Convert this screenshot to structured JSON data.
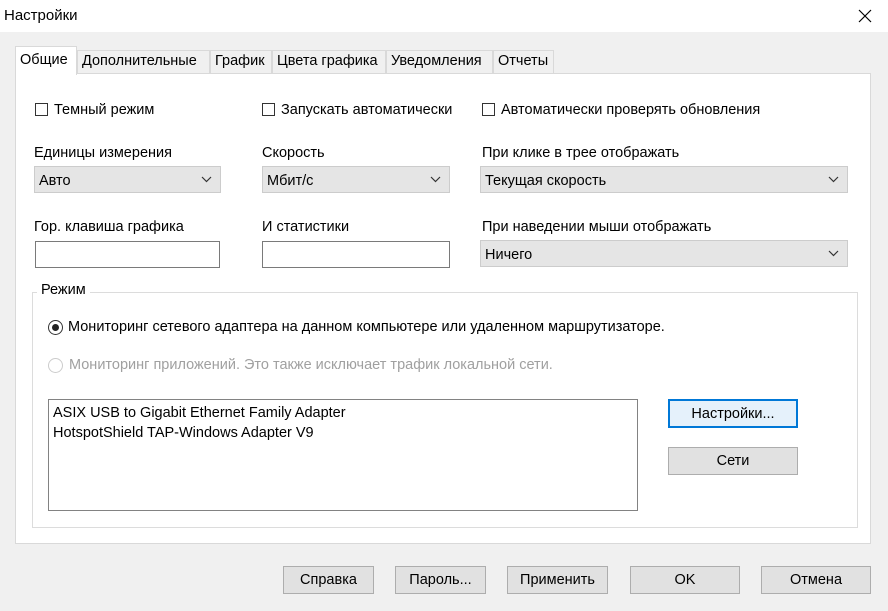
{
  "window": {
    "title": "Настройки"
  },
  "tabs": [
    {
      "label": "Общие",
      "active": true
    },
    {
      "label": "Дополнительные"
    },
    {
      "label": "График"
    },
    {
      "label": "Цвета графика"
    },
    {
      "label": "Уведомления"
    },
    {
      "label": "Отчеты"
    }
  ],
  "general": {
    "dark_mode": {
      "label": "Темный режим",
      "checked": false
    },
    "autostart": {
      "label": "Запускать автоматически",
      "checked": false
    },
    "auto_update": {
      "label": "Автоматически проверять обновления",
      "checked": false
    },
    "units": {
      "label": "Единицы измерения",
      "value": "Авто"
    },
    "speed": {
      "label": "Скорость",
      "value": "Мбит/с"
    },
    "tray_click": {
      "label": "При клике в трее отображать",
      "value": "Текущая скорость"
    },
    "graph_hotkey": {
      "label": "Гор. клавиша графика",
      "value": ""
    },
    "stats_hotkey": {
      "label": "И статистики",
      "value": ""
    },
    "hover": {
      "label": "При наведении мыши отображать",
      "value": "Ничего"
    }
  },
  "mode": {
    "title": "Режим",
    "option_adapter": {
      "label": "Мониторинг сетевого адаптера на данном компьютере или удаленном маршрутизаторе.",
      "selected": true
    },
    "option_apps": {
      "label": "Мониторинг приложений. Это также исключает трафик локальной сети.",
      "selected": false,
      "disabled": true
    },
    "adapters": [
      "ASIX USB to Gigabit Ethernet Family Adapter",
      "HotspotShield TAP-Windows Adapter V9"
    ],
    "settings_button": "Настройки...",
    "networks_button": "Сети"
  },
  "footer": {
    "help": "Справка",
    "password": "Пароль...",
    "apply": "Применить",
    "ok": "OK",
    "cancel": "Отмена"
  },
  "colors": {
    "accent": "#0078d7",
    "button_bg": "#e1e1e1",
    "combo_bg": "#e5e5e5"
  },
  "icons": {
    "close": "close-icon",
    "dropdown": "chevron-down-icon"
  }
}
